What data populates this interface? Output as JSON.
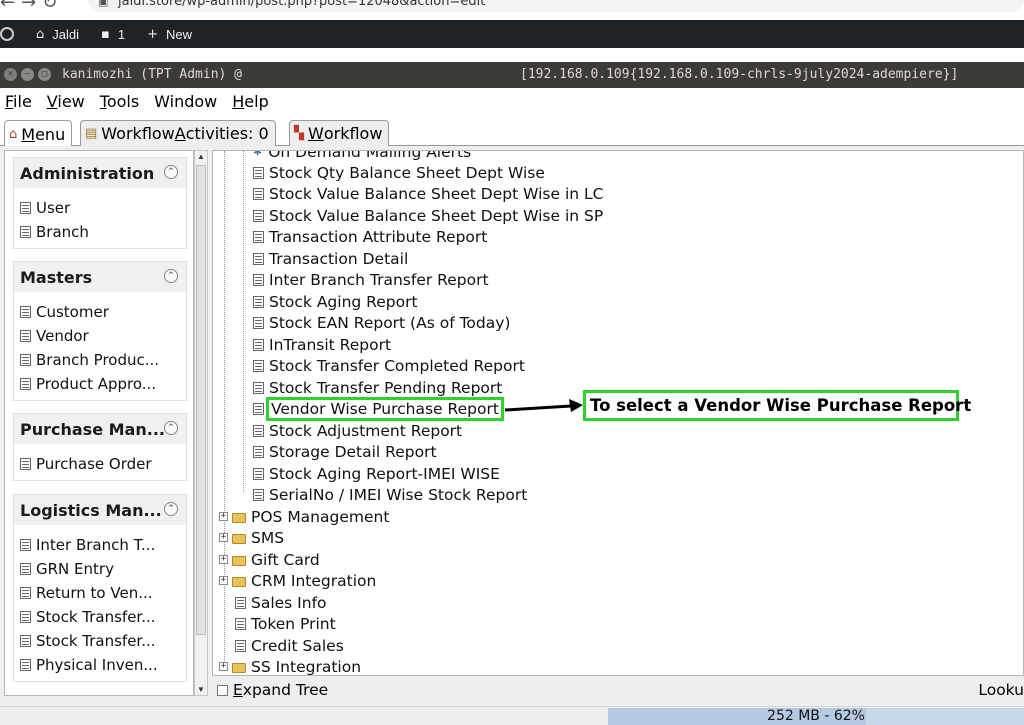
{
  "browser": {
    "url": "jaldi.store/wp-admin/post.php?post=12048&action=edit"
  },
  "wp_admin_bar": {
    "site_name": "Jaldi",
    "comments_count": "1",
    "new_label": "New"
  },
  "window": {
    "user": "kanimozhi (TPT Admin) @",
    "server": "[192.168.0.109{192.168.0.109-chrls-9july2024-adempiere}]"
  },
  "menubar": {
    "items": [
      {
        "prefix": "",
        "mnemonic": "F",
        "rest": "ile"
      },
      {
        "prefix": "",
        "mnemonic": "V",
        "rest": "iew"
      },
      {
        "prefix": "",
        "mnemonic": "T",
        "rest": "ools"
      },
      {
        "prefix": "Window",
        "mnemonic": "",
        "rest": ""
      },
      {
        "prefix": "",
        "mnemonic": "H",
        "rest": "elp"
      }
    ]
  },
  "tabs": {
    "menu": {
      "mnemonic": "M",
      "rest": "enu"
    },
    "workflow_activities": {
      "pre": "Workflow ",
      "mnemonic": "A",
      "rest": "ctivities: 0"
    },
    "workflow": {
      "pre": "",
      "mnemonic": "W",
      "rest": "orkflow"
    }
  },
  "sidebar": {
    "groups": [
      {
        "title": "Administration",
        "items": [
          "User",
          "Branch"
        ]
      },
      {
        "title": "Masters",
        "items": [
          "Customer",
          "Vendor",
          "Branch Produc...",
          "Product Appro..."
        ]
      },
      {
        "title": "Purchase Man...",
        "items": [
          "Purchase Order"
        ]
      },
      {
        "title": "Logistics Man...",
        "items": [
          "Inter Branch T...",
          "GRN Entry",
          "Return to Ven...",
          "Stock Transfer...",
          "Stock Transfer...",
          "Physical Inven..."
        ]
      }
    ]
  },
  "tree": {
    "reports": [
      "On Demand Mailing Alerts",
      "Stock Qty Balance Sheet Dept Wise",
      "Stock Value Balance Sheet Dept Wise in LC",
      "Stock Value Balance Sheet Dept Wise in SP",
      "Transaction Attribute Report",
      "Transaction Detail",
      "Inter Branch Transfer Report",
      "Stock Aging Report",
      "Stock EAN Report (As of Today)",
      "InTransit Report",
      "Stock Transfer Completed Report",
      "Stock Transfer Pending Report",
      "Vendor Wise Purchase Report",
      "Stock Adjustment Report",
      "Storage Detail Report",
      "Stock Aging Report-IMEI WISE",
      "SerialNo / IMEI Wise Stock Report"
    ],
    "top_level": [
      {
        "label": "POS Management",
        "type": "folder"
      },
      {
        "label": "SMS",
        "type": "folder"
      },
      {
        "label": "Gift Card",
        "type": "folder"
      },
      {
        "label": "CRM Integration",
        "type": "folder"
      },
      {
        "label": "Sales Info",
        "type": "doc"
      },
      {
        "label": "Token Print",
        "type": "doc"
      },
      {
        "label": "Credit Sales",
        "type": "doc"
      },
      {
        "label": "SS Integration",
        "type": "folder"
      }
    ]
  },
  "bottom": {
    "expand_tree_mnemonic": "E",
    "expand_tree_rest": "xpand Tree",
    "lookup": "Looku"
  },
  "status": {
    "memory": "252 MB - 62%",
    "memory_fraction": 0.62
  },
  "annotation": {
    "text": "To select a Vendor Wise Purchase Report",
    "highlight_color": "#2fd12f"
  }
}
